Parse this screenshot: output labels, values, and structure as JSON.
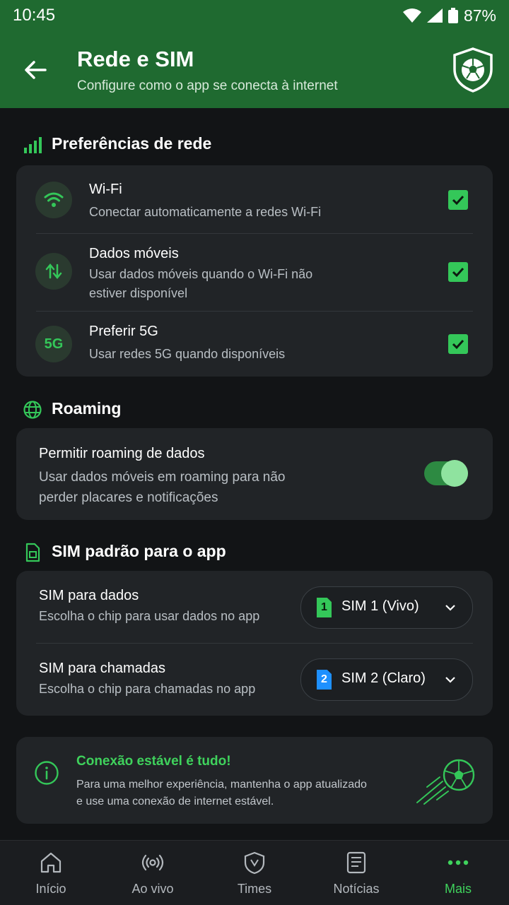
{
  "status": {
    "time": "10:45",
    "battery": "87%"
  },
  "header": {
    "title": "Rede e SIM",
    "subtitle": "Configure como o app se conecta à internet"
  },
  "network": {
    "title": "Preferências de rede",
    "items": [
      {
        "title": "Wi-Fi",
        "subtitle": "Conectar automaticamente a redes Wi-Fi",
        "checked": true
      },
      {
        "title": "Dados móveis",
        "subtitle_line1": "Usar dados móveis quando o Wi-Fi não",
        "subtitle_line2": "estiver disponível",
        "checked": true
      },
      {
        "title": "Preferir 5G",
        "icon_text": "5G",
        "subtitle": "Usar redes 5G quando disponíveis",
        "checked": true
      }
    ]
  },
  "roaming": {
    "title": "Roaming",
    "item": {
      "title": "Permitir roaming de dados",
      "subtitle_line1": "Usar dados móveis em roaming para não",
      "subtitle_line2": "perder placares e notificações",
      "enabled": true
    }
  },
  "sim": {
    "title": "SIM padrão para o app",
    "data": {
      "title": "SIM para dados",
      "subtitle": "Escolha o chip para usar dados no app",
      "badge": "1",
      "value": "SIM 1 (Vivo)"
    },
    "calls": {
      "title": "SIM para chamadas",
      "subtitle": "Escolha o chip para chamadas no app",
      "badge": "2",
      "value": "SIM 2 (Claro)"
    }
  },
  "info": {
    "title": "Conexão estável é tudo!",
    "line1": "Para uma melhor experiência, mantenha o app atualizado",
    "line2": "e use uma conexão de internet estável."
  },
  "nav": [
    {
      "label": "Início",
      "icon": "home-icon"
    },
    {
      "label": "Ao vivo",
      "icon": "live-icon"
    },
    {
      "label": "Times",
      "icon": "teams-shield-icon"
    },
    {
      "label": "Notícias",
      "icon": "news-icon"
    },
    {
      "label": "Mais",
      "icon": "more-icon",
      "active": true
    }
  ],
  "colors": {
    "accent": "#34c759",
    "header": "#1f6a30",
    "background": "#121416",
    "card": "#212427"
  }
}
